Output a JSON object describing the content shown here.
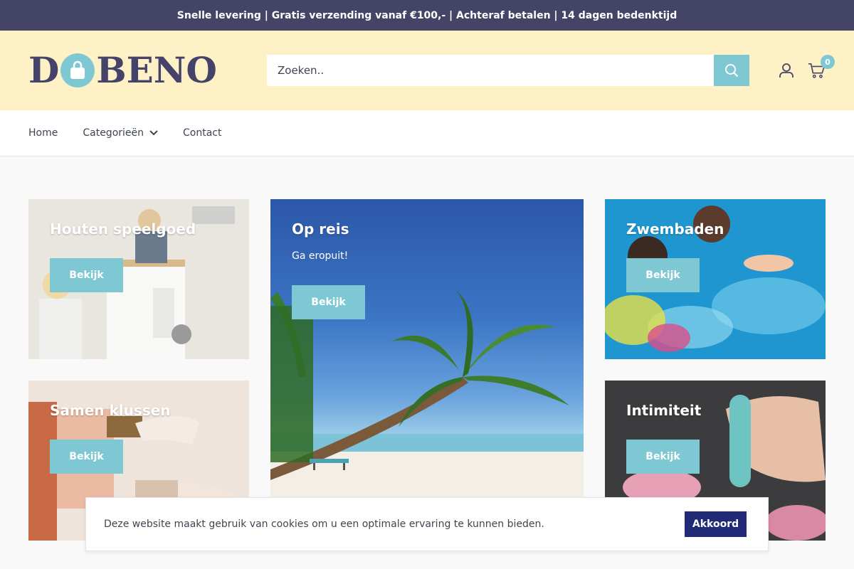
{
  "announcement": "Snelle levering | Gratis verzending vanaf €100,- | Achteraf betalen | 14 dagen bedenktijd",
  "brand": {
    "left": "D",
    "right": "BENO"
  },
  "search": {
    "placeholder": "Zoeken.."
  },
  "cart": {
    "count": "0"
  },
  "nav": {
    "home": "Home",
    "categories": "Categorieën",
    "contact": "Contact"
  },
  "tiles": {
    "houten": {
      "title": "Houten speelgoed",
      "button": "Bekijk"
    },
    "klussen": {
      "title": "Samen klussen",
      "button": "Bekijk"
    },
    "reis": {
      "title": "Op reis",
      "subtitle": "Ga eropuit!",
      "button": "Bekijk"
    },
    "zwembaden": {
      "title": "Zwembaden",
      "button": "Bekijk"
    },
    "intimiteit": {
      "title": "Intimiteit",
      "button": "Bekijk"
    }
  },
  "cookie": {
    "message": "Deze website maakt gebruik van cookies om u een optimale ervaring te kunnen bieden.",
    "accept": "Akkoord"
  },
  "colors": {
    "announcement_bg": "#444467",
    "header_bg": "#fef1c6",
    "accent": "#7ec8d4",
    "brand": "#45436a",
    "accept_button": "#212a76"
  }
}
